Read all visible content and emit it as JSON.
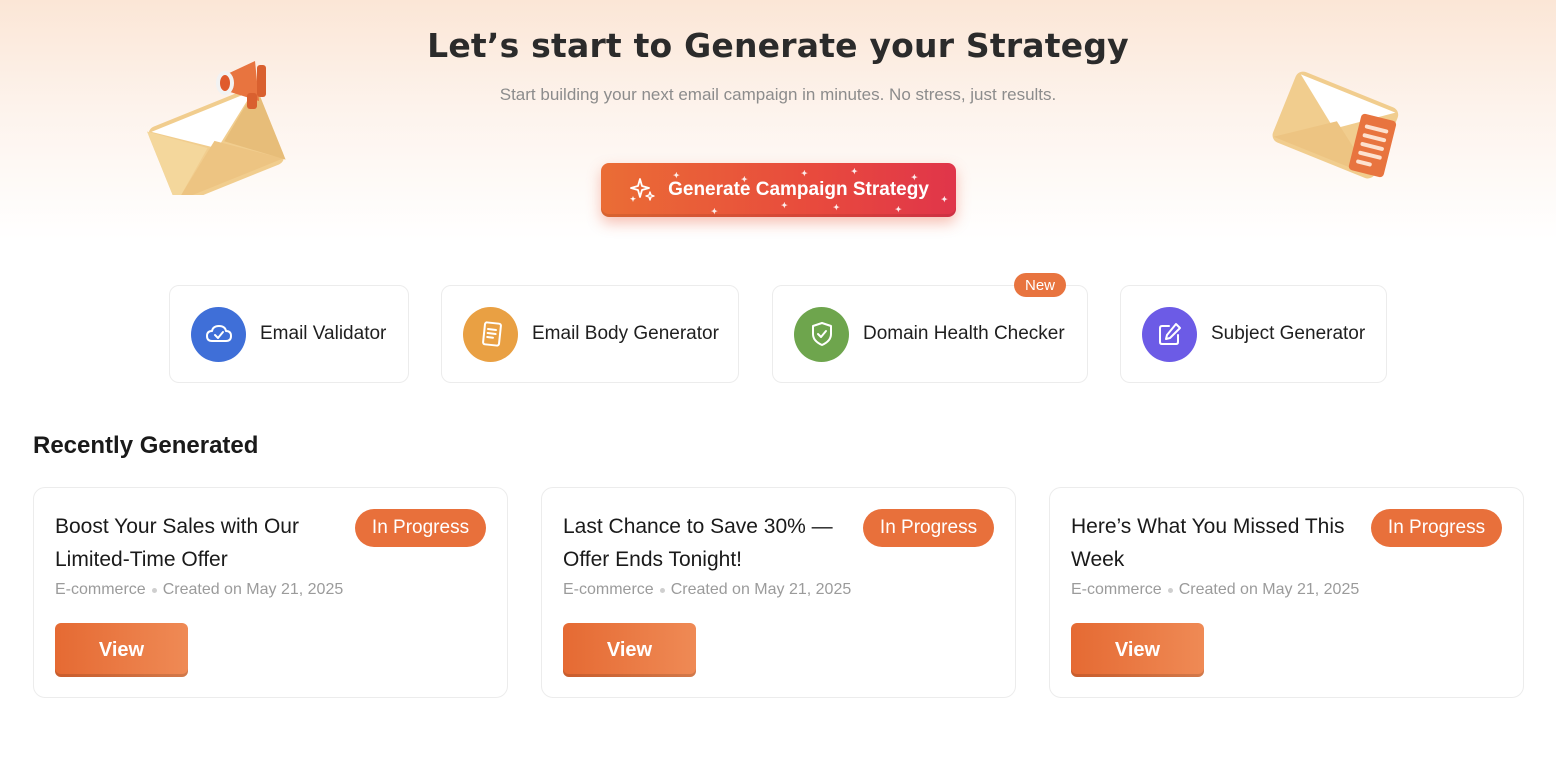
{
  "hero": {
    "title": "Let’s start to Generate your Strategy",
    "subtitle": "Start building your next email campaign in minutes. No stress, just results.",
    "cta_label": "Generate Campaign Strategy"
  },
  "tools": [
    {
      "label": "Email Validator",
      "icon": "cloud-check-icon",
      "color": "#3f6fd8"
    },
    {
      "label": "Email Body Generator",
      "icon": "document-icon",
      "color": "#e9a043"
    },
    {
      "label": "Domain Health Checker",
      "icon": "shield-check-icon",
      "color": "#6ea54d",
      "badge": "New"
    },
    {
      "label": "Subject Generator",
      "icon": "edit-icon",
      "color": "#6c5be6"
    }
  ],
  "recent": {
    "title": "Recently Generated",
    "cards": [
      {
        "title": "Boost Your Sales with Our Limited-Time Offer",
        "status": "In Progress",
        "category": "E-commerce",
        "created": "Created on May 21, 2025",
        "action": "View"
      },
      {
        "title": "Last Chance to Save 30% — Offer Ends Tonight!",
        "status": "In Progress",
        "category": "E-commerce",
        "created": "Created on May 21, 2025",
        "action": "View"
      },
      {
        "title": "Here’s What You Missed This Week",
        "status": "In Progress",
        "category": "E-commerce",
        "created": "Created on May 21, 2025",
        "action": "View"
      }
    ]
  },
  "colors": {
    "accent": "#e8703b",
    "cta_start": "#ea6d35",
    "cta_end": "#e0354a"
  }
}
